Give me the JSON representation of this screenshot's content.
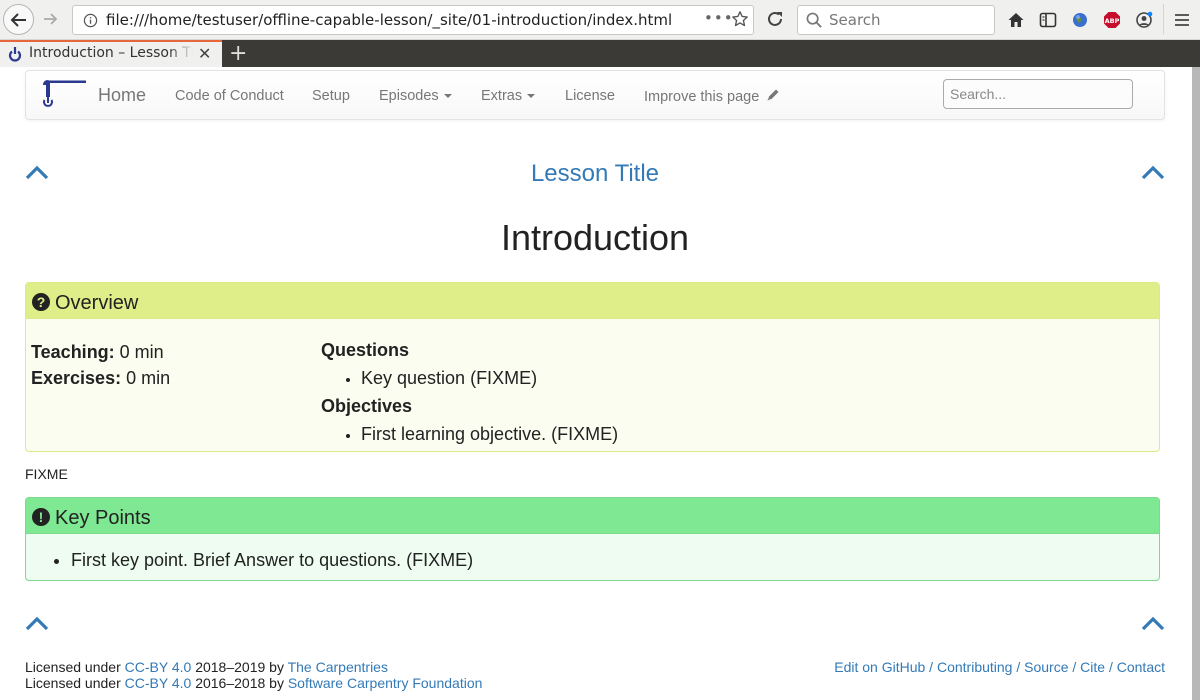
{
  "browser": {
    "url": "file:///home/testuser/offline-capable-lesson/_site/01-introduction/index.html",
    "search_placeholder": "Search",
    "page_actions": "•••",
    "tab": {
      "title": "Introduction – Lesson Title",
      "close": "✕"
    },
    "new_tab": "+",
    "icons": [
      "back-icon",
      "forward-icon",
      "info-icon",
      "page-actions-icon",
      "bookmark-star-icon",
      "reload-icon",
      "search-icon",
      "home-icon",
      "reader-view-icon",
      "globe-extension-icon",
      "adblock-plus-icon",
      "account-icon",
      "hamburger-menu-icon"
    ],
    "adblock_label": "ABP"
  },
  "nav": {
    "home": "Home",
    "items": [
      {
        "label": "Code of Conduct",
        "dropdown": false
      },
      {
        "label": "Setup",
        "dropdown": false
      },
      {
        "label": "Episodes",
        "dropdown": true
      },
      {
        "label": "Extras",
        "dropdown": true
      },
      {
        "label": "License",
        "dropdown": false
      },
      {
        "label": "Improve this page",
        "dropdown": false,
        "icon": "pencil-icon"
      }
    ],
    "search_placeholder": "Search..."
  },
  "content": {
    "lesson_title": "Lesson Title",
    "page_title": "Introduction",
    "overview": {
      "heading": "Overview",
      "icon_glyph": "?",
      "teaching_label": "Teaching:",
      "teaching_value": " 0 min",
      "exercises_label": "Exercises:",
      "exercises_value": " 0 min",
      "questions_heading": "Questions",
      "questions": [
        "Key question (FIXME)"
      ],
      "objectives_heading": "Objectives",
      "objectives": [
        "First learning objective. (FIXME)"
      ]
    },
    "body_text": "FIXME",
    "keypoints": {
      "heading": "Key Points",
      "icon_glyph": "!",
      "items": [
        "First key point. Brief Answer to questions. (FIXME)"
      ]
    }
  },
  "footer": {
    "line1": {
      "prefix": "Licensed under ",
      "license": "CC-BY 4.0",
      "years": " 2018–2019 by ",
      "org": "The Carpentries"
    },
    "line2": {
      "prefix": "Licensed under ",
      "license": "CC-BY 4.0",
      "years": " 2016–2018 by ",
      "org": "Software Carpentry Foundation"
    },
    "links": [
      "Edit on GitHub",
      "Contributing",
      "Source",
      "Cite",
      "Contact"
    ],
    "separator": " / "
  },
  "colors": {
    "link": "#337ab7",
    "overview_header": "#dfee88",
    "overview_body": "#fbfdf0",
    "keypoints_header": "#7ee893",
    "keypoints_body": "#eefcf1",
    "logo": "#2b3990",
    "tab_accent": "#e5673b"
  }
}
